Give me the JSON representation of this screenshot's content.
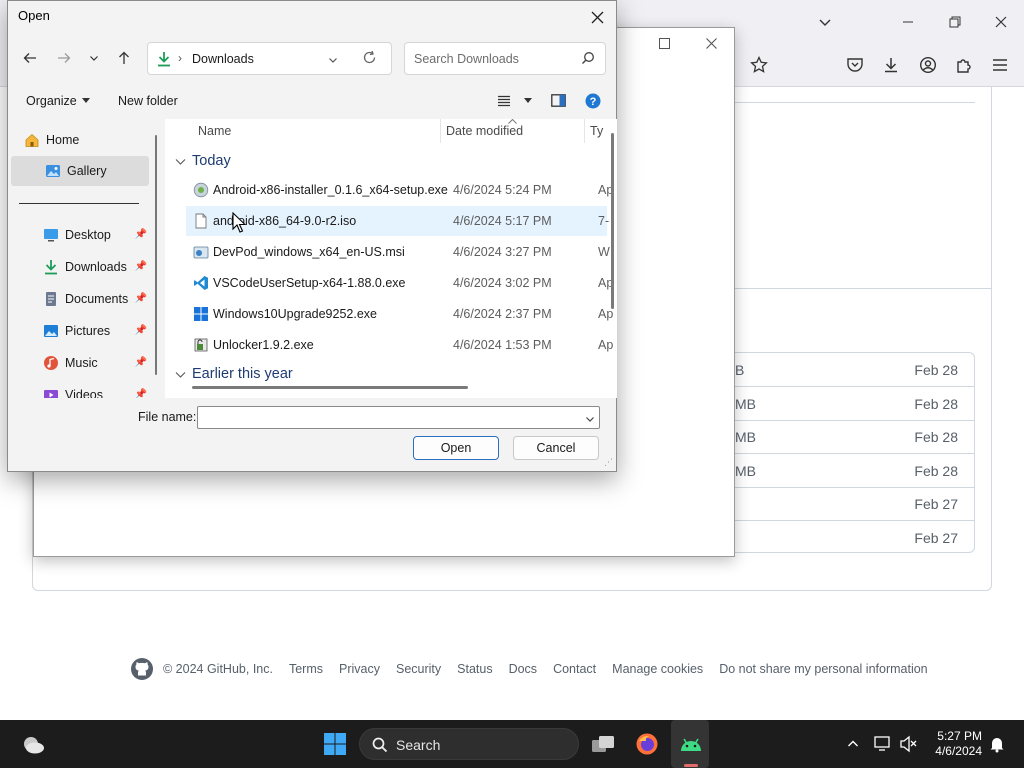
{
  "dialog": {
    "title": "Open",
    "address": {
      "folder": "Downloads"
    },
    "search_placeholder": "Search Downloads",
    "commands": {
      "organize": "Organize",
      "new_folder": "New folder"
    },
    "nav_items": [
      {
        "label": "Home",
        "icon": "home-icon"
      },
      {
        "label": "Gallery",
        "icon": "gallery-icon",
        "selected": true
      },
      {
        "label": "Desktop",
        "icon": "desktop-icon",
        "pinned": true
      },
      {
        "label": "Downloads",
        "icon": "downloads-icon",
        "pinned": true
      },
      {
        "label": "Documents",
        "icon": "documents-icon",
        "pinned": true
      },
      {
        "label": "Pictures",
        "icon": "pictures-icon",
        "pinned": true
      },
      {
        "label": "Music",
        "icon": "music-icon",
        "pinned": true
      },
      {
        "label": "Videos",
        "icon": "videos-icon",
        "pinned": true
      }
    ],
    "columns": {
      "name": "Name",
      "date": "Date modified",
      "type": "Ty"
    },
    "groups": {
      "today": "Today",
      "earlier": "Earlier this year"
    },
    "files": [
      {
        "name": "Android-x86-installer_0.1.6_x64-setup.exe",
        "date": "4/6/2024 5:24 PM",
        "type": "Ap",
        "icon": "installer-icon"
      },
      {
        "name": "android-x86_64-9.0-r2.iso",
        "date": "4/6/2024 5:17 PM",
        "type": "7-",
        "icon": "iso-file-icon"
      },
      {
        "name": "DevPod_windows_x64_en-US.msi",
        "date": "4/6/2024 3:27 PM",
        "type": "W",
        "icon": "msi-icon"
      },
      {
        "name": "VSCodeUserSetup-x64-1.88.0.exe",
        "date": "4/6/2024 3:02 PM",
        "type": "Ap",
        "icon": "vscode-icon"
      },
      {
        "name": "Windows10Upgrade9252.exe",
        "date": "4/6/2024 2:37 PM",
        "type": "Ap",
        "icon": "windows-icon"
      },
      {
        "name": "Unlocker1.9.2.exe",
        "date": "4/6/2024 1:53 PM",
        "type": "Ap",
        "icon": "unlocker-icon"
      }
    ],
    "filename_label": "File name:",
    "filename_value": "",
    "open_button": "Open",
    "cancel_button": "Cancel"
  },
  "github": {
    "file_rows": [
      {
        "size": "B",
        "date": "Feb 28"
      },
      {
        "size": "MB",
        "date": "Feb 28"
      },
      {
        "size": "MB",
        "date": "Feb 28"
      },
      {
        "size": "MB",
        "date": "Feb 28"
      },
      {
        "size": "",
        "date": "Feb 27"
      },
      {
        "size": "",
        "date": "Feb 27"
      }
    ],
    "footer": {
      "copyright": "© 2024 GitHub, Inc.",
      "links": [
        "Terms",
        "Privacy",
        "Security",
        "Status",
        "Docs",
        "Contact",
        "Manage cookies",
        "Do not share my personal information"
      ]
    }
  },
  "taskbar": {
    "search_label": "Search",
    "time": "5:27 PM",
    "date": "4/6/2024"
  },
  "colors": {
    "accent": "#0067c0",
    "taskbar": "#1c1c1c",
    "hover_row": "#e5f3ff"
  }
}
